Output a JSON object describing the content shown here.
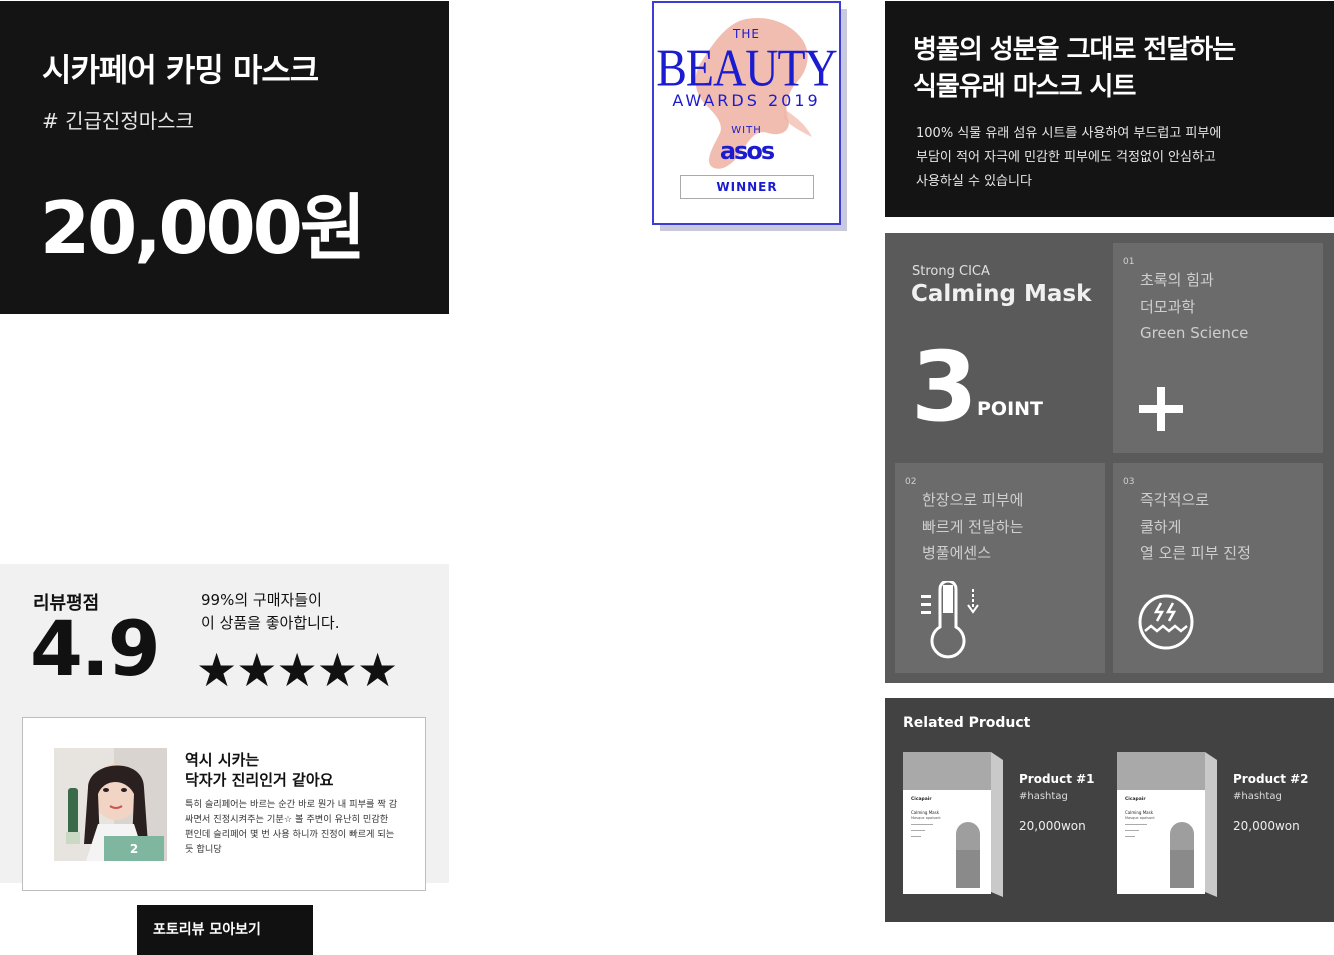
{
  "product_card": {
    "name": "시카페어 카밍 마스크",
    "hashtag": "# 긴급진정마스크",
    "price": "20,000원"
  },
  "award": {
    "the": "THE",
    "beauty": "BEAUTY",
    "awards": "AWARDS 2019",
    "with": "WITH",
    "asos": "asos",
    "winner": "WINNER"
  },
  "intro": {
    "title_line1": "병풀의 성분을 그대로 전달하는",
    "title_line2": "식물유래 마스크 시트",
    "desc_line1": "100% 식물 유래 섬유 시트를 사용하여 부드럽고 피부에",
    "desc_line2": "부담이 적어 자극에 민감한 피부에도 걱정없이 안심하고",
    "desc_line3": "사용하실 수 있습니다"
  },
  "points": {
    "subtitle": "Strong CICA",
    "title": "Calming Mask",
    "number": "3",
    "point_label": "POINT",
    "tiles": [
      {
        "index": "01",
        "lines": [
          "초록의 힘과",
          "더모과학",
          "Green Science"
        ],
        "icon": "plus-icon"
      },
      {
        "index": "02",
        "lines": [
          "한장으로 피부에",
          "빠르게 전달하는",
          "병풀에센스"
        ],
        "icon": "thermometer-icon"
      },
      {
        "index": "03",
        "lines": [
          "즉각적으로",
          "쿨하게",
          "열 오른 피부 진정"
        ],
        "icon": "soothing-skin-icon"
      }
    ]
  },
  "review": {
    "label": "리뷰평점",
    "score": "4.9",
    "pct_line1": "99%의 구매자들이",
    "pct_line2": "이 상품을 좋아합니다.",
    "stars": "★★★★★",
    "rating": 5,
    "card_title_line1": "역시 시카는",
    "card_title_line2": "닥자가 진리인거 같아요",
    "card_body": [
      "특히 슬리페어는 바르는 순간 바로 뭔가 내 피부를 짝 감",
      "싸면서 진정시켜주는 기분☆ 볼 주변이 유난히 민감한",
      "편인데 슬리페어 몇 번 사용 하니까 진정이 빠르게 되는",
      "듯 합니당"
    ],
    "button_label": "포토리뷰 모아보기"
  },
  "related": {
    "heading": "Related Product",
    "products": [
      {
        "name": "Product #1",
        "hashtag": "#hashtag",
        "price": "20,000won"
      },
      {
        "name": "Product #2",
        "hashtag": "#hashtag",
        "price": "20,000won"
      }
    ],
    "box_brand": "Cicapair",
    "box_product": "Calming Mask",
    "box_sub": "Masque apaisant"
  },
  "colors": {
    "dark_card": "#141414",
    "points_panel": "#5a5a5a",
    "tile": "#6b6b6b",
    "related_bg": "#424242",
    "award_blue": "#1b1bd0",
    "review_bg": "#f1f1f1"
  }
}
